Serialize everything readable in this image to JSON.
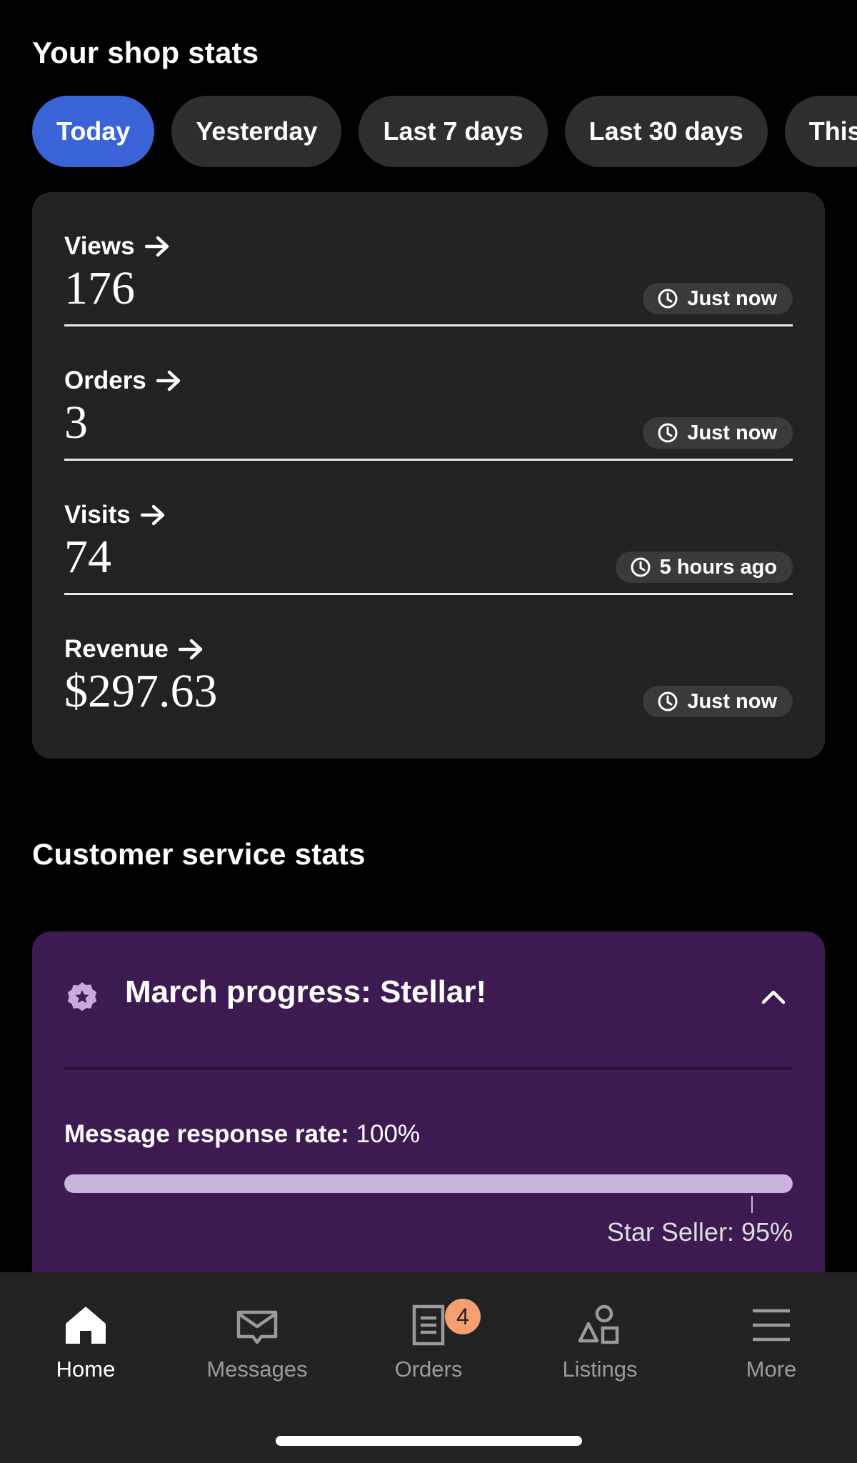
{
  "shop_stats": {
    "title": "Your shop stats",
    "filters": [
      "Today",
      "Yesterday",
      "Last 7 days",
      "Last 30 days",
      "This"
    ],
    "active_filter": "Today",
    "stats": [
      {
        "label": "Views",
        "value": "176",
        "updated": "Just now"
      },
      {
        "label": "Orders",
        "value": "3",
        "updated": "Just now"
      },
      {
        "label": "Visits",
        "value": "74",
        "updated": "5 hours ago"
      },
      {
        "label": "Revenue",
        "value": "$297.63",
        "updated": "Just now"
      }
    ]
  },
  "customer_service": {
    "title": "Customer service stats",
    "progress_title": "March progress: Stellar!",
    "rate_label": "Message response rate:",
    "rate_value": "100%",
    "rate_fraction": 1.0,
    "star_seller_label": "Star Seller: 95%",
    "star_seller_threshold": 0.95,
    "accent_color": "#3d1b52"
  },
  "bottom_nav": {
    "items": [
      {
        "label": "Home",
        "icon": "home-icon",
        "active": true
      },
      {
        "label": "Messages",
        "icon": "mail-icon",
        "active": false
      },
      {
        "label": "Orders",
        "icon": "orders-icon",
        "active": false,
        "badge": "4"
      },
      {
        "label": "Listings",
        "icon": "shapes-icon",
        "active": false
      },
      {
        "label": "More",
        "icon": "menu-icon",
        "active": false
      }
    ]
  }
}
